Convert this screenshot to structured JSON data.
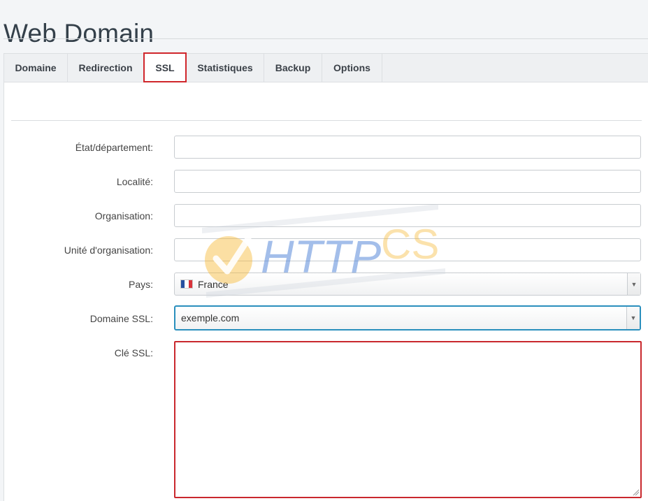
{
  "header": {
    "title": "Web Domain"
  },
  "tabs": [
    {
      "label": "Domaine"
    },
    {
      "label": "Redirection"
    },
    {
      "label": "SSL",
      "active": true
    },
    {
      "label": "Statistiques"
    },
    {
      "label": "Backup"
    },
    {
      "label": "Options"
    }
  ],
  "form": {
    "state_label": "État/département:",
    "state_value": "",
    "locality_label": "Localité:",
    "locality_value": "",
    "organisation_label": "Organisation:",
    "organisation_value": "",
    "unit_label": "Unité d'organisation:",
    "unit_value": "",
    "country_label": "Pays:",
    "country_value": "France",
    "ssl_domain_label": "Domaine SSL:",
    "ssl_domain_value": "exemple.com",
    "ssl_key_label": "Clé SSL:",
    "ssl_key_value": ""
  },
  "watermark": {
    "text_blue": "HTTP",
    "text_orange": "CS"
  },
  "colors": {
    "active_tab_border": "#d0262b",
    "focus_border": "#2a8fbd",
    "error_border": "#c9282d",
    "watermark_blue": "#4a7fd6",
    "watermark_orange": "#f7b733"
  }
}
